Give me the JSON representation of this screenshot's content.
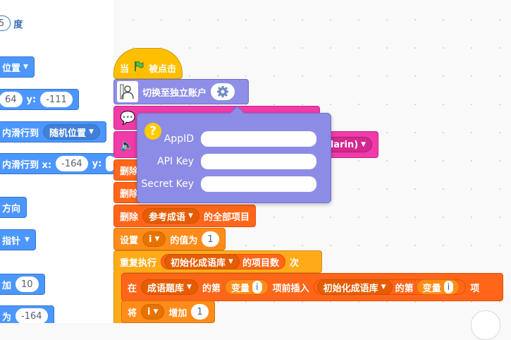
{
  "palette": {
    "degrees_value": "5",
    "degrees_label": "度",
    "position_dd": "位置",
    "x_value": "64",
    "y_label": "y:",
    "y_value": "-111",
    "glide_to_label": "内滑行到",
    "random_position": "随机位置",
    "glide_xy_label": "内滑行到 x:",
    "glide_x_value": "-164",
    "glide_y_label": "y:",
    "direction_label": "方向",
    "pointer_label": "指针",
    "add_label": "加",
    "add_value": "10",
    "set_to_label": "为",
    "set_to_value": "-164"
  },
  "script": {
    "hat_prefix": "当",
    "hat_suffix": "被点击",
    "switch_account": "切换至独立账户",
    "mandarin_frag": "darin)",
    "delete_frag1": "删除",
    "delete_frag2": "删除",
    "delete_label": "删除",
    "ref_idioms": "参考成语",
    "all_items": "的全部项目",
    "set_label": "设置",
    "var_i": "i",
    "value_label": "的值为",
    "set_value": "1",
    "repeat_label": "重复执行",
    "init_lib": "初始化成语库",
    "item_count": "的项目数",
    "times": "次",
    "in_label": "在",
    "idiom_lib": "成语题库",
    "nth_label": "的第",
    "var_label": "变量",
    "insert_before": "项前插入",
    "init_lib2": "初始化成语库",
    "nth_label2": "的第",
    "var_label2": "变量",
    "item_label": "项",
    "change_label": "将",
    "increase_label": "增加",
    "increase_value": "1"
  },
  "popover": {
    "help_symbol": "?",
    "fields": [
      {
        "label": "AppID",
        "value": ""
      },
      {
        "label": "API Key",
        "value": ""
      },
      {
        "label": "Secret Key",
        "value": ""
      }
    ]
  },
  "colors": {
    "motion": "#4c97ff",
    "events": "#ffbf00",
    "variables": "#ff8c1a",
    "lists": "#ff661a",
    "extension": "#8f8fe8",
    "sound": "#f03ba8"
  }
}
